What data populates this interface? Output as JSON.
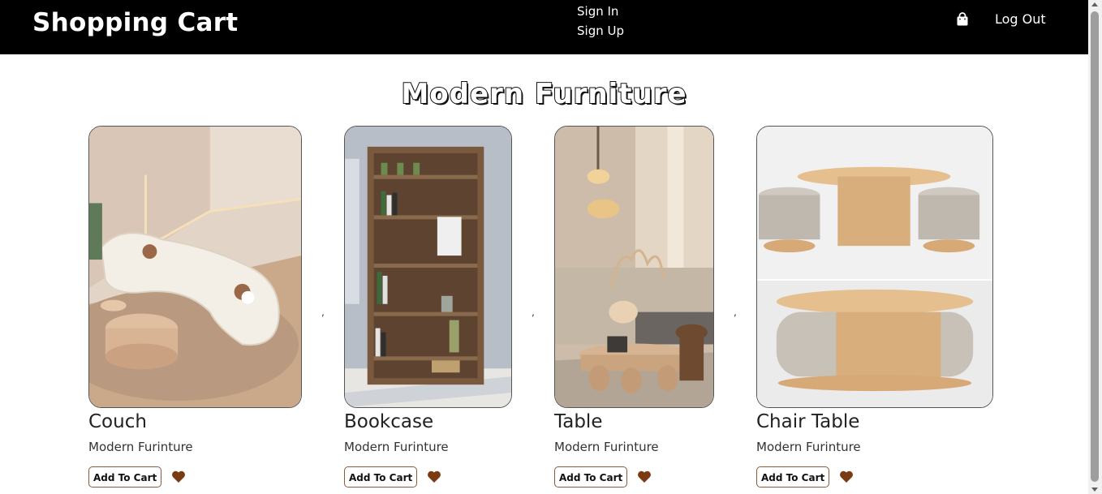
{
  "navbar": {
    "brand": "Shopping Cart",
    "sign_in": "Sign In",
    "sign_up": "Sign Up",
    "cart_icon": "shopping-bag-icon",
    "log_out": "Log Out"
  },
  "page": {
    "heading": "Modern Furniture"
  },
  "separator": ",",
  "products": [
    {
      "name": "Couch",
      "category": "Modern Furinture",
      "add_to_cart": "Add To Cart",
      "favorite_icon": "heart-icon"
    },
    {
      "name": "Bookcase",
      "category": "Modern Furinture",
      "add_to_cart": "Add To Cart",
      "favorite_icon": "heart-icon"
    },
    {
      "name": "Table",
      "category": "Modern Furinture",
      "add_to_cart": "Add To Cart",
      "favorite_icon": "heart-icon"
    },
    {
      "name": "Chair Table",
      "category": "Modern Furinture",
      "add_to_cart": "Add To Cart",
      "favorite_icon": "heart-icon"
    }
  ],
  "colors": {
    "navbar": "#000000",
    "accent": "#7a3b12",
    "background": "#ffffff"
  }
}
